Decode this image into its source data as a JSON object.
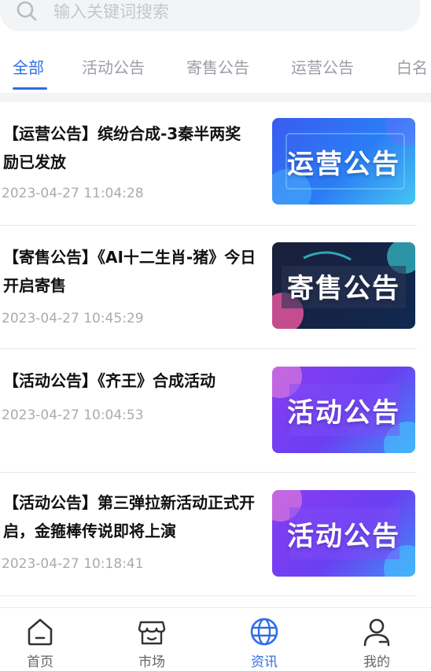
{
  "search": {
    "placeholder": "输入关键词搜索"
  },
  "tabs": [
    {
      "label": "全部",
      "active": true
    },
    {
      "label": "活动公告",
      "active": false
    },
    {
      "label": "寄售公告",
      "active": false
    },
    {
      "label": "运营公告",
      "active": false
    },
    {
      "label": "白名",
      "active": false
    }
  ],
  "news": [
    {
      "title": "【运营公告】缤纷合成-3秦半两奖励已发放",
      "time": "2023-04-27 11:04:28",
      "thumb_text": "运营公告",
      "thumb_style": "blue"
    },
    {
      "title": "【寄售公告】《AI十二生肖-猪》今日开启寄售",
      "time": "2023-04-27 10:45:29",
      "thumb_text": "寄售公告",
      "thumb_style": "dark"
    },
    {
      "title": "【活动公告】《齐王》合成活动",
      "time": "2023-04-27 10:04:53",
      "thumb_text": "活动公告",
      "thumb_style": "purple"
    },
    {
      "title": "【活动公告】第三弹拉新活动正式开启，金箍棒传说即将上演",
      "time": "2023-04-27 10:18:41",
      "thumb_text": "活动公告",
      "thumb_style": "purple"
    }
  ],
  "bottom_nav": [
    {
      "label": "首页",
      "icon": "home-icon",
      "active": false
    },
    {
      "label": "市场",
      "icon": "market-icon",
      "active": false
    },
    {
      "label": "资讯",
      "icon": "globe-icon",
      "active": true
    },
    {
      "label": "我的",
      "icon": "user-icon",
      "active": false
    }
  ],
  "colors": {
    "accent": "#2f6fe0",
    "muted": "#9a9ea6",
    "time": "#a8abb1"
  }
}
